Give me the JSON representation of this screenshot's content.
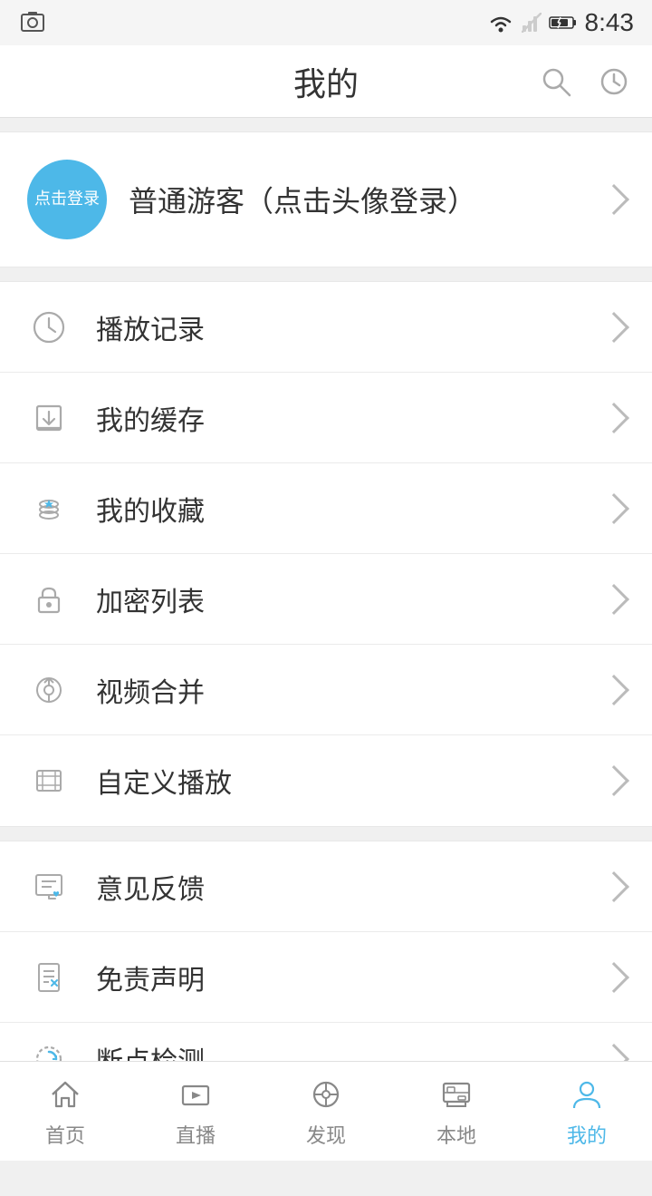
{
  "statusBar": {
    "time": "8:43"
  },
  "header": {
    "title": "我的",
    "searchLabel": "search",
    "historyLabel": "history"
  },
  "profile": {
    "avatarText": "点击登录",
    "name": "普通游客（点击头像登录）"
  },
  "menuGroup1": [
    {
      "id": "playback",
      "label": "播放记录",
      "icon": "clock"
    },
    {
      "id": "cache",
      "label": "我的缓存",
      "icon": "download"
    },
    {
      "id": "favorite",
      "label": "我的收藏",
      "icon": "star-stack"
    },
    {
      "id": "encrypt",
      "label": "加密列表",
      "icon": "lock"
    },
    {
      "id": "merge",
      "label": "视频合并",
      "icon": "merge"
    },
    {
      "id": "custom",
      "label": "自定义播放",
      "icon": "film"
    }
  ],
  "menuGroup2": [
    {
      "id": "feedback",
      "label": "意见反馈",
      "icon": "feedback"
    },
    {
      "id": "disclaimer",
      "label": "免责声明",
      "icon": "disclaimer"
    },
    {
      "id": "update",
      "label": "断点检测",
      "icon": "update"
    }
  ],
  "bottomNav": [
    {
      "id": "home",
      "label": "首页",
      "icon": "home",
      "active": false
    },
    {
      "id": "live",
      "label": "直播",
      "icon": "live",
      "active": false
    },
    {
      "id": "discover",
      "label": "发现",
      "icon": "discover",
      "active": false
    },
    {
      "id": "local",
      "label": "本地",
      "icon": "local",
      "active": false
    },
    {
      "id": "mine",
      "label": "我的",
      "icon": "mine",
      "active": true
    }
  ]
}
